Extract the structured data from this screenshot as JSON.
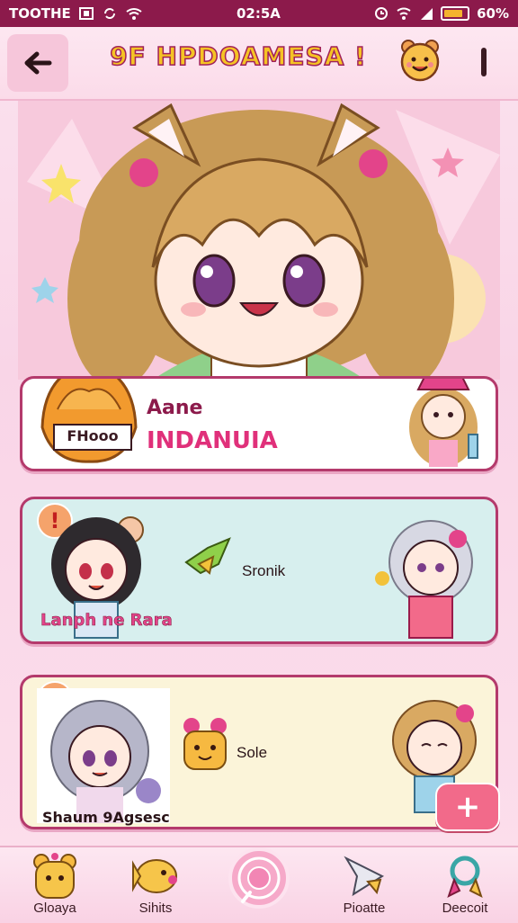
{
  "status_bar": {
    "carrier": "TOOTHE",
    "time": "02:5A",
    "battery": "60%"
  },
  "header": {
    "title": "9F HPDOAMESA !",
    "back_icon": "arrow-left-icon",
    "mascot_icon": "smiley-mascot-icon",
    "menu_icon": "vertical-bar-icon"
  },
  "cards": [
    {
      "avatar_label": "FHooo",
      "name": "Aane",
      "subtitle": "INDANUIA"
    },
    {
      "badge": "!",
      "caption": "Lanph ne Rara",
      "item_label": "Sronik"
    },
    {
      "badge": "!",
      "caption": "Shaum 9Agsesc",
      "item_label": "Sole"
    }
  ],
  "fab": {
    "label": "+"
  },
  "bottom_nav": [
    {
      "label": "Gloaya",
      "icon": "yellow-bear-icon"
    },
    {
      "label": "Sihits",
      "icon": "yellow-fish-icon"
    },
    {
      "label": "",
      "icon": "pink-circle-target-icon"
    },
    {
      "label": "Pioatte",
      "icon": "paper-plane-icon"
    },
    {
      "label": "Deecoit",
      "icon": "ribbon-icon"
    }
  ],
  "colors": {
    "accent": "#8c1a4b",
    "title_fill": "#f5c324",
    "card_border": "#b43a6c",
    "fab": "#f26a8a"
  }
}
